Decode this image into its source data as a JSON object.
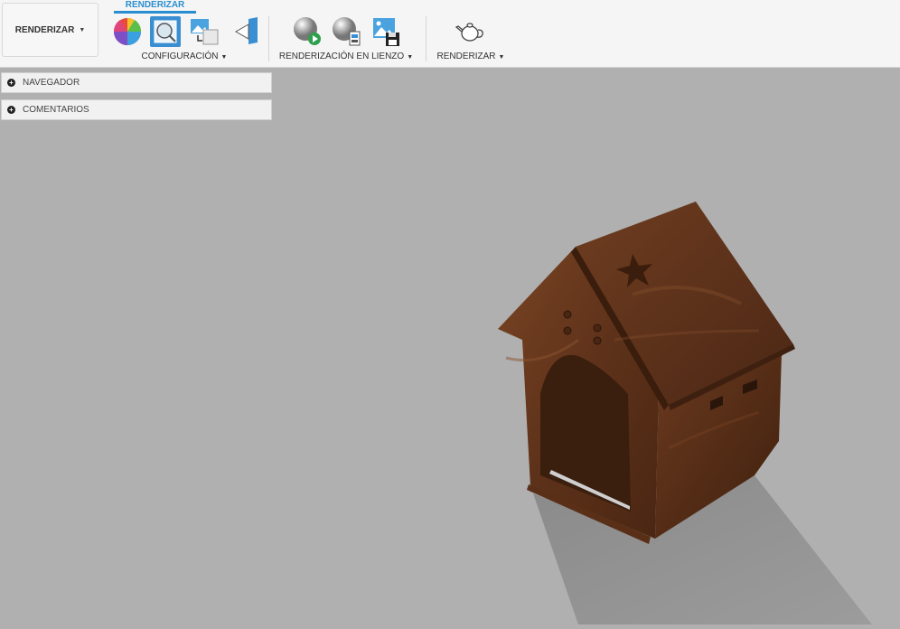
{
  "toolbar": {
    "workspace_label": "RENDERIZAR",
    "active_tab": "RENDERIZAR",
    "groups": {
      "config": "CONFIGURACIÓN",
      "canvas": "RENDERIZACIÓN EN LIENZO",
      "render": "RENDERIZAR"
    },
    "tools": [
      {
        "name": "appearance-icon"
      },
      {
        "name": "scene-settings-icon"
      },
      {
        "name": "texture-map-icon"
      },
      {
        "name": "decal-icon"
      },
      {
        "name": "in-canvas-render-icon"
      },
      {
        "name": "in-canvas-render-settings-icon"
      },
      {
        "name": "capture-image-icon"
      },
      {
        "name": "render-teapot-icon"
      }
    ]
  },
  "panels": {
    "browser": "NAVEGADOR",
    "comments": "COMENTARIOS"
  },
  "colors": {
    "accent": "#2a8fd0",
    "viewport_bg": "#b0b0b0",
    "wood": "#6b3a1f"
  }
}
